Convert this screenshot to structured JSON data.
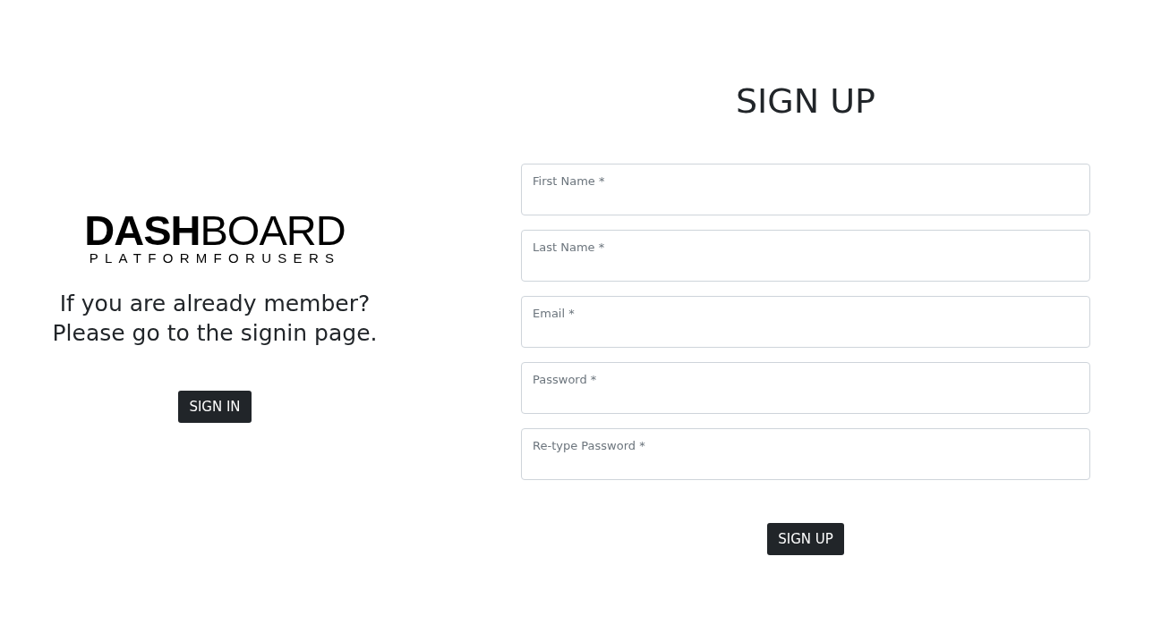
{
  "logo": {
    "bold": "DASH",
    "regular": "BOARD",
    "tagline": "PLATFORMFORUSERS"
  },
  "message": [
    "If you are already member?",
    "Please go to the signin page."
  ],
  "signin_button": "SIGN IN",
  "title": "SIGN UP",
  "fields": [
    {
      "placeholder": "First Name *"
    },
    {
      "placeholder": "Last Name *"
    },
    {
      "placeholder": "Email *"
    },
    {
      "placeholder": "Password *"
    },
    {
      "placeholder": "Re-type Password *"
    }
  ],
  "signup_button": "SIGN UP"
}
